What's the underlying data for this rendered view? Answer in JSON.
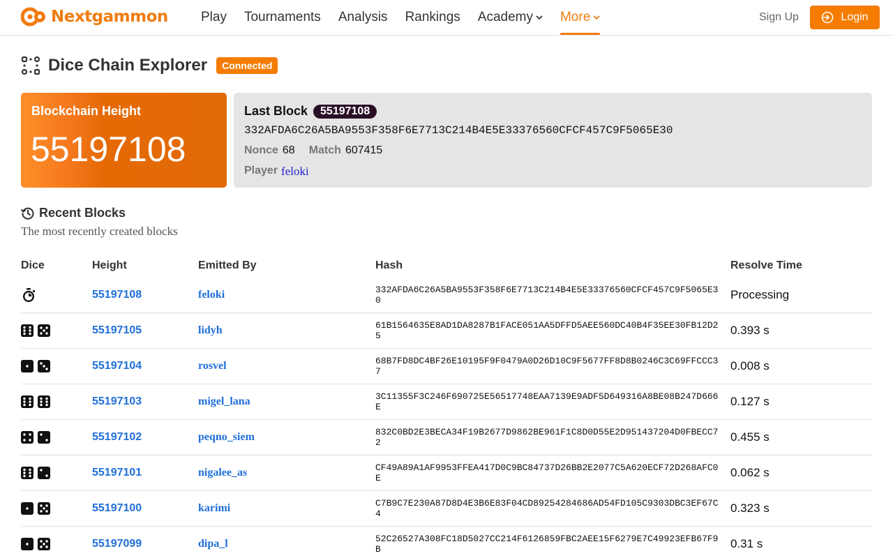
{
  "brand": {
    "name": "Nextgammon",
    "color": "#f07c10"
  },
  "nav": {
    "items": [
      {
        "label": "Play",
        "dropdown": false,
        "active": false
      },
      {
        "label": "Tournaments",
        "dropdown": false,
        "active": false
      },
      {
        "label": "Analysis",
        "dropdown": false,
        "active": false
      },
      {
        "label": "Rankings",
        "dropdown": false,
        "active": false
      },
      {
        "label": "Academy",
        "dropdown": true,
        "active": false
      },
      {
        "label": "More",
        "dropdown": true,
        "active": true
      }
    ],
    "signup_label": "Sign Up",
    "login_label": "Login"
  },
  "page": {
    "title": "Dice Chain Explorer",
    "status_badge": "Connected",
    "title_icon": "dice-nodes-icon"
  },
  "height_card": {
    "label": "Blockchain Height",
    "value": "55197108"
  },
  "last_block": {
    "label": "Last Block",
    "height": "55197108",
    "hash": "332AFDA6C26A5BA9553F358F6E7713C214B4E5E33376560CFCF457C9F5065E30",
    "nonce_label": "Nonce",
    "nonce": "68",
    "match_label": "Match",
    "match": "607415",
    "player_label": "Player",
    "player": "feloki"
  },
  "recent": {
    "title": "Recent Blocks",
    "subtitle": "The most recently created blocks",
    "columns": {
      "dice": "Dice",
      "height": "Height",
      "by": "Emitted By",
      "hash": "Hash",
      "time": "Resolve Time"
    },
    "rows": [
      {
        "dice": [],
        "processing": true,
        "height": "55197108",
        "by": "feloki",
        "hash": "332AFDA6C26A5BA9553F358F6E7713C214B4E5E33376560CFCF457C9F5065E30",
        "time": "Processing"
      },
      {
        "dice": [
          6,
          5
        ],
        "height": "55197105",
        "by": "lidyh",
        "hash": "61B1564635E8AD1DA8287B1FACE051AA5DFFD5AEE560DC40B4F35EE30FB12D25",
        "time": "0.393 s"
      },
      {
        "dice": [
          1,
          3
        ],
        "height": "55197104",
        "by": "rosvel",
        "hash": "68B7FD8DC4BF26E10195F9F0479A0D26D10C9F5677FF8D8B0246C3C69FFCCC37",
        "time": "0.008 s"
      },
      {
        "dice": [
          6,
          6
        ],
        "height": "55197103",
        "by": "migel_lana",
        "hash": "3C11355F3C246F690725E56517748EAA7139E9ADF5D649316A8BE08B247D666E",
        "time": "0.127 s"
      },
      {
        "dice": [
          4,
          2
        ],
        "height": "55197102",
        "by": "peqno_siem",
        "hash": "832C0BD2E3BECA34F19B2677D9862BE961F1C8D0D55E2D951437204D0FBECC72",
        "time": "0.455 s"
      },
      {
        "dice": [
          6,
          2
        ],
        "height": "55197101",
        "by": "nigalee_as",
        "hash": "CF49A89A1AF9953FFEA417D0C9BC84737D26BB2E2077C5A620ECF72D268AFC0E",
        "time": "0.062 s"
      },
      {
        "dice": [
          1,
          5
        ],
        "height": "55197100",
        "by": "karimi",
        "hash": "C7B9C7E230A87D8D4E3B6E83F04CD89254284686AD54FD105C9303DBC3EF67C4",
        "time": "0.323 s"
      },
      {
        "dice": [
          1,
          5
        ],
        "height": "55197099",
        "by": "dipa_l",
        "hash": "52C26527A308FC18D5027CC214F6126859FBC2AEE15F6279E7C49923EFB67F9B",
        "time": "0.31 s"
      }
    ]
  }
}
